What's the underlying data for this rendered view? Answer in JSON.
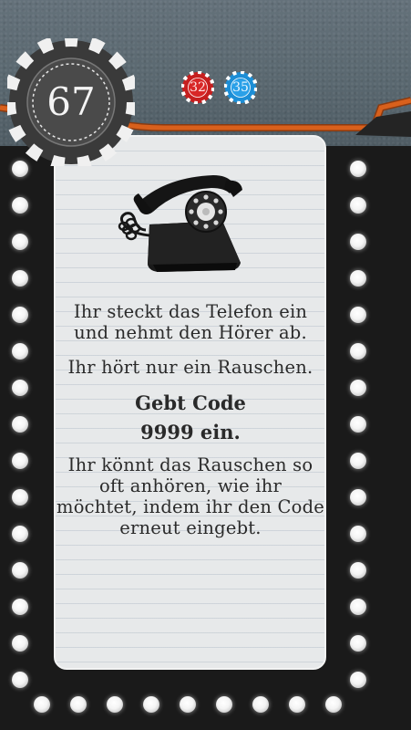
{
  "card": {
    "number": "67",
    "refs": [
      "32",
      "35"
    ]
  },
  "text": {
    "para1": "Ihr steckt das Telefon ein und nehmt den Hörer ab.",
    "para2": "Ihr hört nur ein Rauschen.",
    "code_line1": "Gebt Code",
    "code_line2": "9999 ein.",
    "para3": "Ihr könnt das Rauschen so oft anhören, wie ihr möchtet, indem ihr den Code erneut eingebt."
  },
  "icons": {
    "card_number_chip": "poker-chip-icon",
    "reference_chips": "poker-chip-icon",
    "illustration": "rotary-telephone-icon",
    "border_lights": "light-bulb-icon"
  },
  "colors": {
    "felt": "#5c6a72",
    "trim": "#d8601c",
    "chip_red": "#c61f1f",
    "chip_blue": "#1c8ed6",
    "paper": "#e7e9ea",
    "text": "#2a2a2a"
  }
}
